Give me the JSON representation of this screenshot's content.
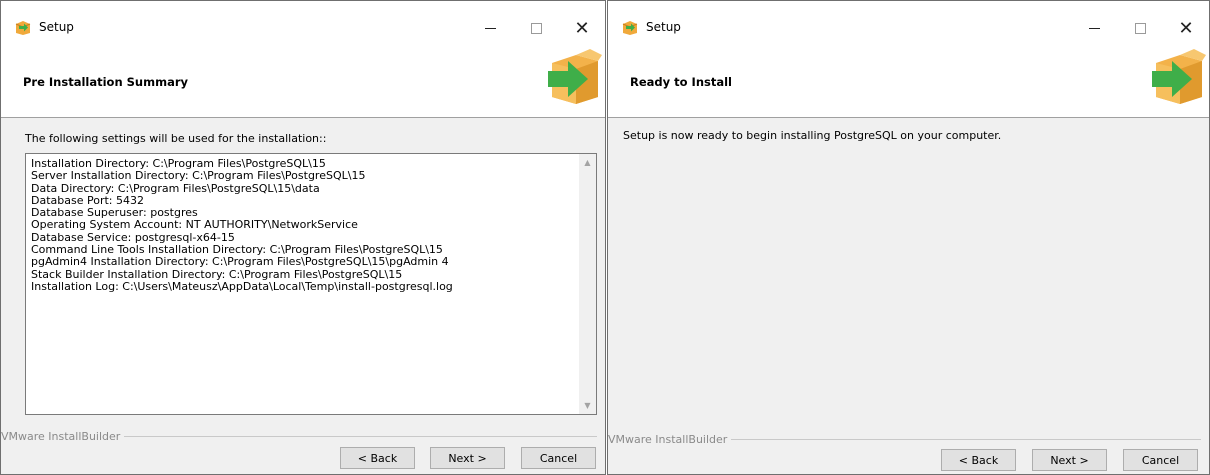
{
  "left_window": {
    "title": "Setup",
    "header_title": "Pre Installation Summary",
    "intro": "The following settings will be used for the installation::",
    "summary_lines": [
      "Installation Directory: C:\\Program Files\\PostgreSQL\\15",
      "Server Installation Directory: C:\\Program Files\\PostgreSQL\\15",
      "Data Directory: C:\\Program Files\\PostgreSQL\\15\\data",
      "Database Port: 5432",
      "Database Superuser: postgres",
      "Operating System Account: NT AUTHORITY\\NetworkService",
      "Database Service: postgresql-x64-15",
      "Command Line Tools Installation Directory: C:\\Program Files\\PostgreSQL\\15",
      "pgAdmin4 Installation Directory: C:\\Program Files\\PostgreSQL\\15\\pgAdmin 4",
      "Stack Builder Installation Directory: C:\\Program Files\\PostgreSQL\\15",
      "Installation Log: C:\\Users\\Mateusz\\AppData\\Local\\Temp\\install-postgresql.log"
    ],
    "brand": "VMware InstallBuilder",
    "buttons": {
      "back": "< Back",
      "next": "Next >",
      "cancel": "Cancel"
    }
  },
  "right_window": {
    "title": "Setup",
    "header_title": "Ready to Install",
    "message": "Setup is now ready to begin installing PostgreSQL on your computer.",
    "brand": "VMware InstallBuilder",
    "buttons": {
      "back": "< Back",
      "next": "Next >",
      "cancel": "Cancel"
    }
  },
  "icons": {
    "app": "setup-box-icon",
    "minimize": "minimize-icon",
    "maximize": "maximize-icon",
    "close": "close-icon",
    "header_graphic": "box-arrow-icon",
    "scroll_up": "scroll-up-arrow-icon",
    "scroll_down": "scroll-down-arrow-icon"
  },
  "colors": {
    "window_bg": "#f0f0f0",
    "header_bg": "#ffffff",
    "box_orange": "#f0a93b",
    "arrow_green": "#3fae49"
  }
}
